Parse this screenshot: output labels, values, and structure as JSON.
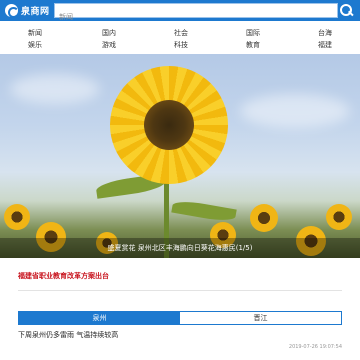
{
  "header": {
    "logo_text": "泉商网",
    "search_placeholder": "新闻"
  },
  "nav": {
    "items": [
      {
        "label": "新闻"
      },
      {
        "label": "国内"
      },
      {
        "label": "社会"
      },
      {
        "label": "国际"
      },
      {
        "label": "台海"
      },
      {
        "label": "娱乐"
      },
      {
        "label": "游戏"
      },
      {
        "label": "科技"
      },
      {
        "label": "教育"
      },
      {
        "label": "福建"
      }
    ]
  },
  "slideshow": {
    "caption": "盛夏赏花 泉州北区丰海鹏向日葵花海惠民(1/5)"
  },
  "headline": {
    "text": "福建省职业教育改革方案出台"
  },
  "tabs": [
    {
      "label": "泉州",
      "active": true
    },
    {
      "label": "晋江",
      "active": false
    }
  ],
  "news": [
    {
      "title": "下周泉州仍多雷雨 气温持续较高",
      "time": "2019-07-26 19:07:54"
    }
  ],
  "colors": {
    "accent": "#1d79cf",
    "headline": "#c8141e"
  }
}
